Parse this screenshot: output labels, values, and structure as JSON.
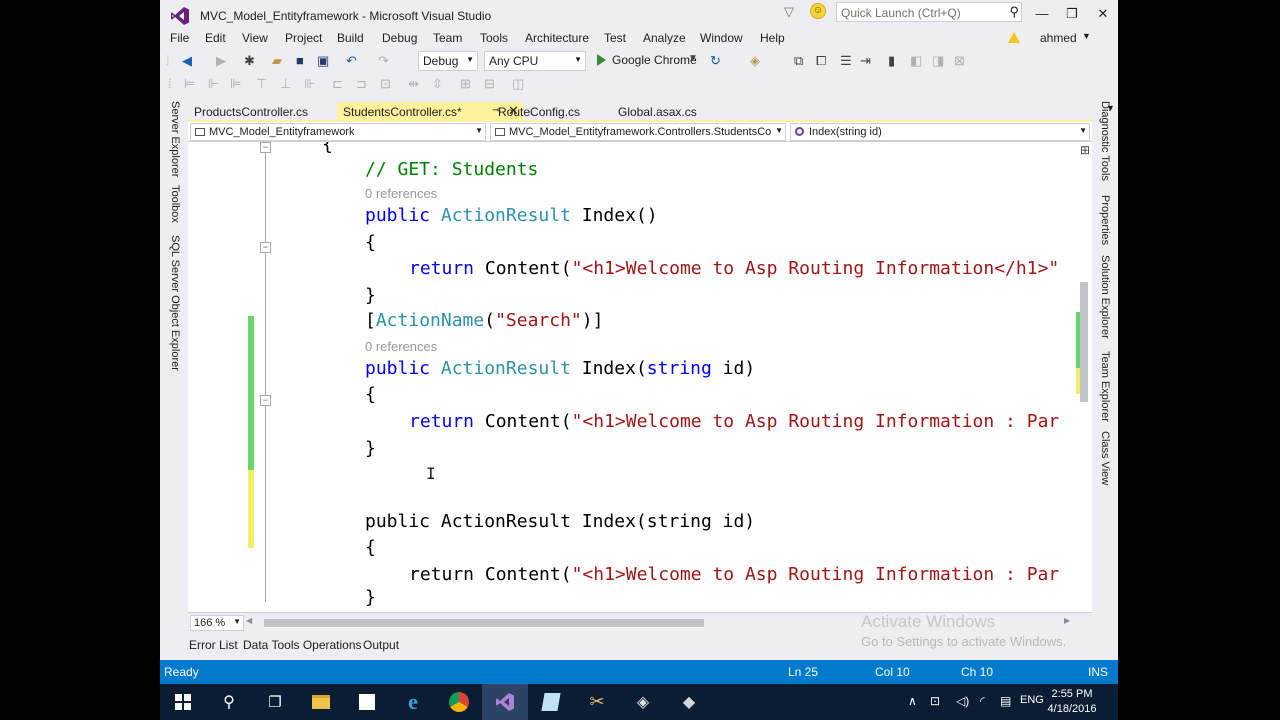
{
  "window": {
    "title": "MVC_Model_Entityframework - Microsoft Visual Studio",
    "quick_launch_placeholder": "Quick Launch (Ctrl+Q)",
    "user": "ahmed"
  },
  "menu": [
    "File",
    "Edit",
    "View",
    "Project",
    "Build",
    "Debug",
    "Team",
    "Tools",
    "Architecture",
    "Test",
    "Analyze",
    "Window",
    "Help"
  ],
  "toolbar": {
    "configuration": "Debug",
    "platform": "Any CPU",
    "run_target": "Google Chrome"
  },
  "tabs": [
    {
      "label": "ProductsController.cs",
      "active": false
    },
    {
      "label": "StudentsController.cs*",
      "active": true
    },
    {
      "label": "RouteConfig.cs",
      "active": false
    },
    {
      "label": "Global.asax.cs",
      "active": false
    }
  ],
  "navbar": {
    "project": "MVC_Model_Entityframework",
    "type": "MVC_Model_Entityframework.Controllers.StudentsCo",
    "member": "Index(string id)"
  },
  "code": {
    "brace_top": "{",
    "comment": "// GET: Students",
    "codelens": "0 references",
    "kw_public": "public",
    "type_actionresult": "ActionResult",
    "sig_index": " Index()",
    "sig_index_id_a": " Index(",
    "kw_string": "string",
    "sig_index_id_b": " id)",
    "open_brace": "{",
    "close_brace": "}",
    "kw_return": "return",
    "content_call": " Content(",
    "str1": "\"<h1>Welcome to Asp Routing Information</h1>\"",
    "str2": "\"<h1>Welcome to Asp Routing Information : Par",
    "attr_open": "[",
    "attr_name": "ActionName",
    "attr_arg_open": "(",
    "attr_arg": "\"Search\"",
    "attr_close": ")]",
    "line3_public_plain": "public ActionResult Index(string id)",
    "line3_body": "return Content(",
    "cursor_brace": "}"
  },
  "zoom": "166 %",
  "side_left": [
    "Server Explorer",
    "Toolbox",
    "SQL Server Object Explorer"
  ],
  "side_right": [
    "Diagnostic Tools",
    "Properties",
    "Solution Explorer",
    "Team Explorer",
    "Class View"
  ],
  "bottom_tabs": [
    "Error List",
    "Data Tools Operations",
    "Output"
  ],
  "watermark": {
    "line1": "Activate Windows",
    "line2": "Go to Settings to activate Windows."
  },
  "status": {
    "state": "Ready",
    "ln": "Ln 25",
    "col": "Col 10",
    "ch": "Ch 10",
    "mode": "INS"
  },
  "taskbar": {
    "lang": "ENG",
    "time": "2:55 PM",
    "date": "4/18/2016"
  },
  "colors": {
    "status_bar": "#007acc",
    "active_tab": "#fff29d",
    "keyword": "#0000ff",
    "type": "#2b91af",
    "string": "#a31515",
    "comment": "#008000"
  }
}
